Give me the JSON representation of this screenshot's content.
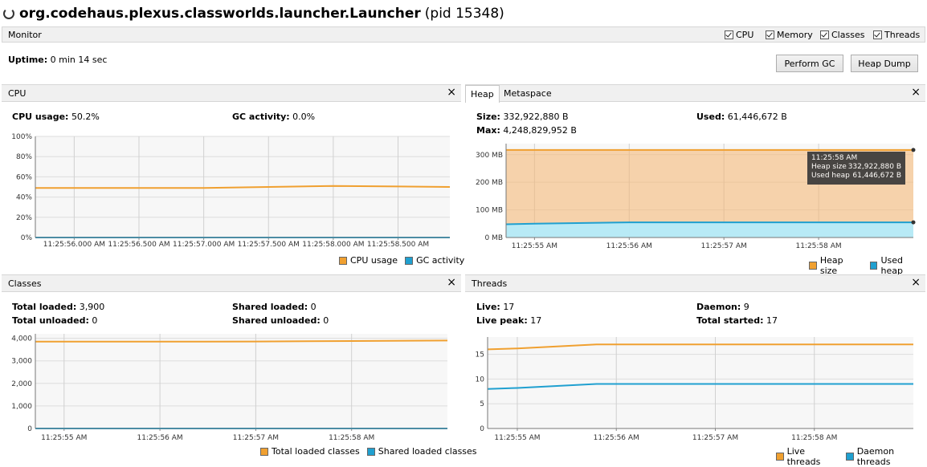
{
  "window": {
    "app_name": "org.codehaus.plexus.classworlds.launcher.Launcher",
    "pid_text": "(pid 15348)"
  },
  "monitor": {
    "label": "Monitor",
    "checkboxes": [
      {
        "label": "CPU",
        "checked": true
      },
      {
        "label": "Memory",
        "checked": true
      },
      {
        "label": "Classes",
        "checked": true
      },
      {
        "label": "Threads",
        "checked": true
      }
    ],
    "uptime_label": "Uptime:",
    "uptime_value": "0 min 14 sec",
    "perform_gc": "Perform GC",
    "heap_dump": "Heap Dump"
  },
  "colors": {
    "orange": "#f0a030",
    "blue": "#20a0d0"
  },
  "cpu": {
    "title": "CPU",
    "usage_label": "CPU usage:",
    "usage_value": "50.2%",
    "gc_label": "GC activity:",
    "gc_value": "0.0%",
    "legend": [
      "CPU usage",
      "GC activity"
    ]
  },
  "heap": {
    "tabs": [
      "Heap",
      "Metaspace"
    ],
    "size_label": "Size:",
    "size_value": "332,922,880 B",
    "used_label": "Used:",
    "used_value": "61,446,672 B",
    "max_label": "Max:",
    "max_value": "4,248,829,952 B",
    "tooltip": {
      "time": "11:25:58 AM",
      "rows": [
        [
          "Heap size",
          "332,922,880 B"
        ],
        [
          "Used heap",
          "61,446,672 B"
        ]
      ]
    },
    "legend": [
      "Heap size",
      "Used heap"
    ]
  },
  "classes": {
    "title": "Classes",
    "total_loaded_label": "Total loaded:",
    "total_loaded_value": "3,900",
    "total_unloaded_label": "Total unloaded:",
    "total_unloaded_value": "0",
    "shared_loaded_label": "Shared loaded:",
    "shared_loaded_value": "0",
    "shared_unloaded_label": "Shared unloaded:",
    "shared_unloaded_value": "0",
    "legend": [
      "Total loaded classes",
      "Shared loaded classes"
    ]
  },
  "threads": {
    "title": "Threads",
    "live_label": "Live:",
    "live_value": "17",
    "live_peak_label": "Live peak:",
    "live_peak_value": "17",
    "daemon_label": "Daemon:",
    "daemon_value": "9",
    "total_started_label": "Total started:",
    "total_started_value": "17",
    "legend": [
      "Live threads",
      "Daemon threads"
    ]
  },
  "chart_data": [
    {
      "type": "line",
      "title": "CPU",
      "x": [
        "11:25:55.700 AM",
        "11:25:56.000 AM",
        "11:25:56.500 AM",
        "11:25:57.000 AM",
        "11:25:57.500 AM",
        "11:25:58.000 AM",
        "11:25:58.500 AM",
        "11:25:58.900 AM"
      ],
      "series": [
        {
          "name": "CPU usage",
          "values": [
            49,
            49,
            49,
            49,
            50,
            51,
            50.5,
            50
          ],
          "color": "#f0a030"
        },
        {
          "name": "GC activity",
          "values": [
            0,
            0,
            0,
            0,
            0,
            0,
            0,
            0
          ],
          "color": "#20a0d0"
        }
      ],
      "xticks": [
        "11:25:56.000 AM",
        "11:25:56.500 AM",
        "11:25:57.000 AM",
        "11:25:57.500 AM",
        "11:25:58.000 AM",
        "11:25:58.500 AM"
      ],
      "yticks": [
        "0%",
        "20%",
        "40%",
        "60%",
        "80%",
        "100%"
      ],
      "ylim": [
        0,
        100
      ]
    },
    {
      "type": "area",
      "title": "Heap",
      "x": [
        "11:25:54.7 AM",
        "11:25:55 AM",
        "11:25:56 AM",
        "11:25:57 AM",
        "11:25:58 AM",
        "11:25:59 AM"
      ],
      "series": [
        {
          "name": "Heap size",
          "values": [
            317,
            317,
            317,
            317,
            317,
            317
          ],
          "color": "#f0a030"
        },
        {
          "name": "Used heap",
          "values": [
            48,
            50,
            55,
            55,
            55,
            55
          ],
          "color": "#20a0d0"
        }
      ],
      "xticks": [
        "11:25:55 AM",
        "11:25:56 AM",
        "11:25:57 AM",
        "11:25:58 AM"
      ],
      "yticks": [
        "0 MB",
        "100 MB",
        "200 MB",
        "300 MB"
      ],
      "ylim": [
        0,
        340
      ]
    },
    {
      "type": "line",
      "title": "Classes",
      "x": [
        "11:25:54.7 AM",
        "11:25:55 AM",
        "11:25:56 AM",
        "11:25:57 AM",
        "11:25:58 AM",
        "11:25:59 AM"
      ],
      "series": [
        {
          "name": "Total loaded classes",
          "values": [
            3850,
            3850,
            3850,
            3860,
            3880,
            3900
          ],
          "color": "#f0a030"
        },
        {
          "name": "Shared loaded classes",
          "values": [
            0,
            0,
            0,
            0,
            0,
            0
          ],
          "color": "#20a0d0"
        }
      ],
      "xticks": [
        "11:25:55 AM",
        "11:25:56 AM",
        "11:25:57 AM",
        "11:25:58 AM"
      ],
      "yticks": [
        "0",
        "1,000",
        "2,000",
        "3,000",
        "4,000"
      ],
      "ylim": [
        0,
        4200
      ]
    },
    {
      "type": "line",
      "title": "Threads",
      "x": [
        "11:25:54.7 AM",
        "11:25:55 AM",
        "11:25:55.8 AM",
        "11:25:56 AM",
        "11:25:57 AM",
        "11:25:58 AM",
        "11:25:59 AM"
      ],
      "series": [
        {
          "name": "Live threads",
          "values": [
            16,
            16.2,
            17,
            17,
            17,
            17,
            17
          ],
          "color": "#f0a030"
        },
        {
          "name": "Daemon threads",
          "values": [
            8,
            8.2,
            9,
            9,
            9,
            9,
            9
          ],
          "color": "#20a0d0"
        }
      ],
      "xticks": [
        "11:25:55 AM",
        "11:25:56 AM",
        "11:25:57 AM",
        "11:25:58 AM"
      ],
      "yticks": [
        "0",
        "5",
        "10",
        "15"
      ],
      "ylim": [
        0,
        18.5
      ]
    }
  ]
}
